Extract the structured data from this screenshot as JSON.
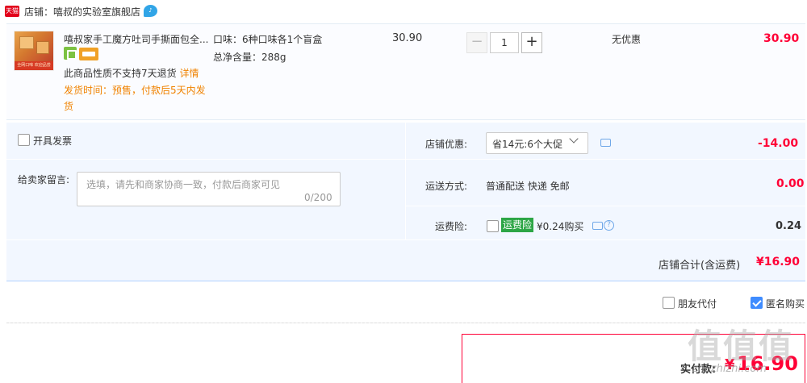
{
  "store": {
    "badge": "天猫",
    "name": "店铺：嘻叔的实验室旗舰店"
  },
  "product": {
    "thumb_band_text": "全网口味 欢迎品尝",
    "title": "嘻叔家手工魔方吐司手撕面包全...",
    "no_return": "此商品性质不支持7天退货",
    "detail_link": "详情",
    "ship_time": "发货时间：预售，付款后5天内发货",
    "sku_flavor": "口味：6种口味各1个盲盒",
    "sku_weight": "总净含量：288g",
    "unit_price": "30.90",
    "qty_minus": "−",
    "quantity": "1",
    "qty_plus": "+",
    "discount": "无优惠",
    "total": "30.90"
  },
  "options": {
    "invoice_label": "开具发票",
    "message_label": "给卖家留言:",
    "message_placeholder": "选填，请先和商家协商一致，付款后商家可见",
    "message_count": "0/200",
    "promo_label": "店铺优惠:",
    "promo_value": "省14元:6个大促",
    "promo_amount": "-14.00",
    "shipping_label": "运送方式:",
    "shipping_value": "普通配送 快递 免邮",
    "shipping_cost": "0.00",
    "insurance_label": "运费险:",
    "insurance_badge": "运费险",
    "insurance_price": "¥0.24购买",
    "insurance_amount": "0.24",
    "help_symbol": "?",
    "subtotal_label": "店铺合计(含运费)",
    "subtotal_value": "¥16.90"
  },
  "footer": {
    "friend_pay_label": "朋友代付",
    "anonymous_label": "匿名购买",
    "anonymous_checked": true,
    "pay_label": "实付款:",
    "pay_currency": "¥",
    "pay_amount": "16.90"
  },
  "watermark": {
    "logo": "值值值",
    "url": "zhi.zhizhi.com"
  },
  "colors": {
    "price_red": "#ff0036",
    "warning_orange": "#f08200",
    "band_blue": "#f2f7ff",
    "insurance_green": "#2da646",
    "check_blue": "#3f8cff"
  }
}
